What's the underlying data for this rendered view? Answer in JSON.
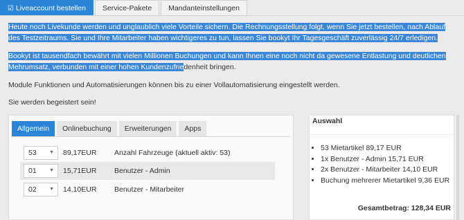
{
  "top_tabs": {
    "live": {
      "icon": "cart-icon",
      "label": "Liveaccount bestellen"
    },
    "service": "Service-Pakete",
    "mandant": "Mandanteinstellungen"
  },
  "intro": {
    "p1": "Heute noch Livekunde werden und unglaublich viele Vorteile sichern. Die Rechnungsstellung folgt, wenn Sie jetzt bestellen, nach Ablauf des Testzeitraums. Sie und Ihre Mitarbeiter haben wichtigeres zu tun, lassen Sie bookyt Ihr Tagesgeschäft zuverlässig 24/7 erledigen.",
    "p2_selected": "Bookyt ist tausendfach bewährt mit vielen Millionen Buchungen und kann Ihnen eine noch nicht da gewesene Entlastung und deutlichen Mehrumsatz, verbunden mit einer hohen Kundenzufrie",
    "p2_rest": "denheit bringen.",
    "p3": "Module Funktionen und Automatisierungen können bis zu einer Vollautomatisierung eingestellt werden.",
    "p4": "Sie werden begeistert sein!"
  },
  "inner_tabs": [
    "Allgemein",
    "Onlinebuchung",
    "Erweiterungen",
    "Apps"
  ],
  "rows": [
    {
      "qty": "53",
      "price": "89,17EUR",
      "desc": "Anzahl Fahrzeuge (aktuell aktiv: 53)"
    },
    {
      "qty": "01",
      "price": "15,71EUR",
      "desc": "Benutzer - Admin"
    },
    {
      "qty": "02",
      "price": "14,10EUR",
      "desc": "Benutzer - Mitarbeiter"
    }
  ],
  "auswahl": {
    "title": "Auswahl",
    "items": [
      "53 Mietartikel 89,17 EUR",
      "1x Benutzer - Admin 15,71 EUR",
      "2x Benutzer - Mitarbeiter 14,10 EUR",
      "Buchung mehrerer Mietartikel 9,36 EUR"
    ],
    "total": "Gesamtbetrag: 128,34 EUR"
  },
  "colors": {
    "accent": "#2a84d8",
    "selection": "#3a86d9",
    "background": "#ebebeb"
  }
}
